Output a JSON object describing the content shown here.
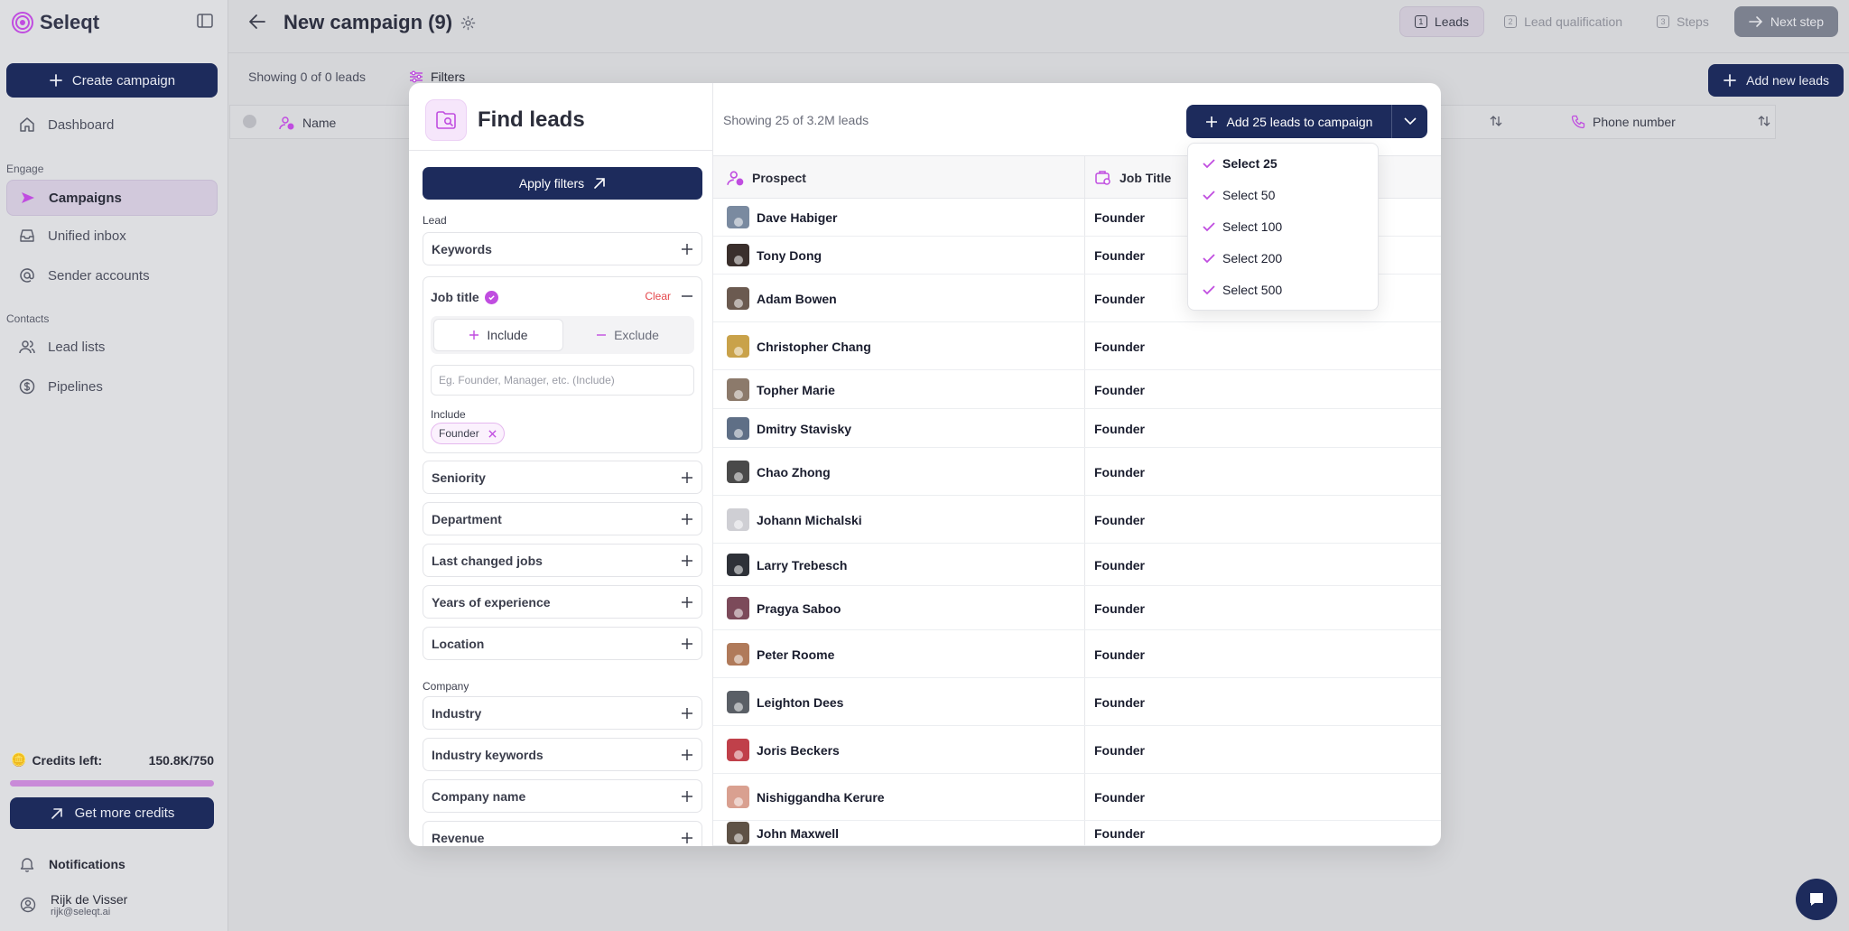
{
  "app": {
    "name": "Seleqt"
  },
  "sidebar": {
    "create_label": "Create campaign",
    "items": [
      {
        "label": "Dashboard"
      },
      {
        "label": "Campaigns"
      },
      {
        "label": "Unified inbox"
      },
      {
        "label": "Sender accounts"
      },
      {
        "label": "Lead lists"
      },
      {
        "label": "Pipelines"
      }
    ],
    "sections": {
      "engage": "Engage",
      "contacts": "Contacts"
    },
    "credits_label": "Credits left:",
    "credits_value": "150.8K/750",
    "credits_fraction": 1.0,
    "more_credits_label": "Get more credits",
    "notifications_label": "Notifications",
    "user_name": "Rijk de Visser",
    "user_email": "rijk@seleqt.ai"
  },
  "header": {
    "title": "New campaign (9)",
    "steps": [
      {
        "num": "1",
        "label": "Leads"
      },
      {
        "num": "2",
        "label": "Lead qualification"
      },
      {
        "num": "3",
        "label": "Steps"
      }
    ],
    "next_label": "Next step"
  },
  "subbar": {
    "showing": "Showing 0 of 0 leads",
    "filters_label": "Filters",
    "add_label": "Add new leads",
    "col_name": "Name",
    "col_phone": "Phone number"
  },
  "modal": {
    "title": "Find leads",
    "apply_label": "Apply filters",
    "lead_group": "Lead",
    "company_group": "Company",
    "filters": {
      "keywords": "Keywords",
      "seniority": "Seniority",
      "department": "Department",
      "last_changed": "Last changed jobs",
      "years": "Years of experience",
      "location": "Location",
      "industry": "Industry",
      "industry_keywords": "Industry keywords",
      "company_name": "Company name",
      "revenue": "Revenue"
    },
    "job_title": {
      "label": "Job title",
      "clear": "Clear",
      "include": "Include",
      "exclude": "Exclude",
      "placeholder": "Eg. Founder, Manager, etc. (Include)",
      "include_label": "Include",
      "chip": "Founder"
    },
    "count": "Showing 25 of 3.2M leads",
    "campaign_btn": "Add 25 leads to campaign",
    "col_prospect": "Prospect",
    "col_job": "Job Title",
    "dropdown": [
      "Select 25",
      "Select 50",
      "Select 100",
      "Select 200",
      "Select 500"
    ],
    "rows": [
      {
        "name": "Dave Habiger",
        "job": "Founder"
      },
      {
        "name": "Tony Dong",
        "job": "Founder"
      },
      {
        "name": "Adam Bowen",
        "job": "Founder"
      },
      {
        "name": "Christopher Chang",
        "job": "Founder"
      },
      {
        "name": "Topher Marie",
        "job": "Founder"
      },
      {
        "name": "Dmitry Stavisky",
        "job": "Founder"
      },
      {
        "name": "Chao Zhong",
        "job": "Founder"
      },
      {
        "name": "Johann Michalski",
        "job": "Founder"
      },
      {
        "name": "Larry Trebesch",
        "job": "Founder"
      },
      {
        "name": "Pragya Saboo",
        "job": "Founder"
      },
      {
        "name": "Peter Roome",
        "job": "Founder"
      },
      {
        "name": "Leighton Dees",
        "job": "Founder"
      },
      {
        "name": "Joris Beckers",
        "job": "Founder"
      },
      {
        "name": "Nishiggandha Kerure",
        "job": "Founder"
      },
      {
        "name": "John Maxwell",
        "job": "Founder"
      }
    ]
  },
  "colors": {
    "brand": "#1d2b5c",
    "accent": "#c04de0"
  }
}
